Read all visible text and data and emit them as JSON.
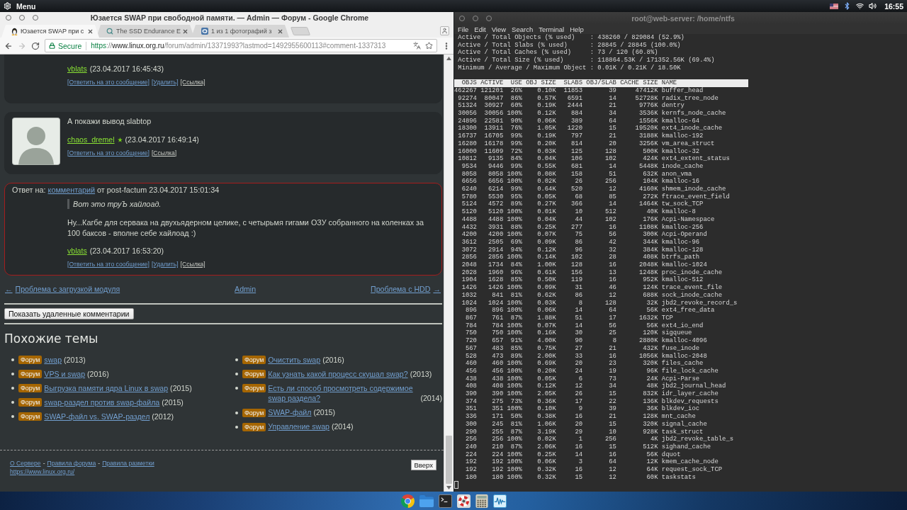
{
  "top_panel": {
    "menu_label": "Menu",
    "clock": "16:55"
  },
  "browser": {
    "title": "Юзается SWAP при свободной памяти. — Admin — Форум - Google Chrome",
    "tabs": [
      {
        "title": "Юзается SWAP при с",
        "kind": "penguin",
        "selected": true
      },
      {
        "title": "The SSD Endurance E",
        "kind": "magnifier",
        "selected": false
      },
      {
        "title": "1 из 1 фотографий з",
        "kind": "tile",
        "selected": false
      }
    ],
    "address": {
      "security": "Secure",
      "scheme": "https",
      "separator": "://",
      "host": "www.linux.org.ru",
      "path": "/forum/admin/13371993?lastmod=1492955600113#comment-1337313"
    }
  },
  "page": {
    "comments": [
      {
        "highlighted": false,
        "avatar": false,
        "author": "vblats",
        "starred": false,
        "time": "(23.04.2017 16:45:43)",
        "actions": [
          {
            "label": "[Ответить на это сообщение]",
            "kind": "action"
          },
          {
            "label": "[Удалить]",
            "kind": "action"
          },
          {
            "label": "[Ссылка]",
            "kind": "permalink"
          }
        ]
      },
      {
        "highlighted": false,
        "avatar": true,
        "text": "А покажи вывод slabtop",
        "author": "chaos_dremel",
        "starred": true,
        "time": "(23.04.2017 16:49:14)",
        "actions": [
          {
            "label": "[Ответить на это сообщение]",
            "kind": "action"
          },
          {
            "label": "[Ссылка]",
            "kind": "permalink"
          }
        ]
      },
      {
        "highlighted": true,
        "avatar": false,
        "reply_to": {
          "prefix": "Ответ на:",
          "link": "комментарий",
          "rest": "от post-factum 23.04.2017 15:01:34"
        },
        "quote": "Вот это труЪ хайлоад.",
        "text": "Ну...Кагбе для сервака на двухьядерном целике, с четырьмя гигами ОЗУ собранного на коленках за 100 баксов - вполне себе хайлоад :)",
        "author": "vblats",
        "starred": false,
        "time": "(23.04.2017 16:53:20)",
        "actions": [
          {
            "label": "[Ответить на это сообщение]",
            "kind": "action"
          },
          {
            "label": "[Удалить]",
            "kind": "action"
          },
          {
            "label": "[Ссылка]",
            "kind": "permalink"
          }
        ]
      }
    ],
    "nav": {
      "prev_arrow": "←",
      "prev": "Проблема с загрузкой модуля",
      "center": "Admin",
      "next": "Проблема с HDD",
      "next_arrow": "→"
    },
    "show_deleted_button": "Показать удаленные комментарии",
    "related": {
      "title": "Похожие темы",
      "columns": [
        [
          {
            "tag": "Форум",
            "title": "swap",
            "year": "(2013)"
          },
          {
            "tag": "Форум",
            "title": "VPS и swap",
            "year": "(2016)"
          },
          {
            "tag": "Форум",
            "title": "Выгрузка памяти ядра Linux в swap",
            "year": "(2015)"
          },
          {
            "tag": "Форум",
            "title": "swap-раздел против swap-файла",
            "year": "(2015)"
          },
          {
            "tag": "Форум",
            "title": "SWAP-файл vs. SWAP-раздел",
            "year": "(2012)"
          }
        ],
        [
          {
            "tag": "Форум",
            "title": "Очистить swap",
            "year": "(2016)"
          },
          {
            "tag": "Форум",
            "title": "Как узнать какой процесс скушал swap?",
            "year": "(2013)"
          },
          {
            "tag": "Форум",
            "title": "Есть ли способ просмотреть содержимое swap раздела?",
            "year": "(2014)"
          },
          {
            "tag": "Форум",
            "title": "SWAP-файл",
            "year": "(2015)"
          },
          {
            "tag": "Форум",
            "title": "Управление swap",
            "year": "(2014)"
          }
        ]
      ]
    },
    "footer": {
      "links": [
        {
          "kind": "link",
          "text": "О Сервере"
        },
        {
          "kind": "separator",
          "text": "-"
        },
        {
          "kind": "link",
          "text": "Правила форума"
        },
        {
          "kind": "separator",
          "text": "-"
        },
        {
          "kind": "link",
          "text": "Правила разметки"
        }
      ],
      "site_url": "https://www.linux.org.ru/",
      "top_button": "Вверх"
    }
  },
  "terminal": {
    "title": "root@web-server: /home/ntfs",
    "menu": [
      "File",
      "Edit",
      "View",
      "Search",
      "Terminal",
      "Help"
    ],
    "summary": [
      "Active / Total Objects (% used)    : 438260 / 829084 (52.9%)",
      "Active / Total Slabs (% used)      : 28845 / 28845 (100.0%)",
      "Active / Total Caches (% used)     : 73 / 120 (60.8%)",
      "Active / Total Size (% used)       : 118864.53K / 171352.56K (69.4%)",
      "Minimum / Average / Maximum Object : 0.01K / 0.21K / 18.50K"
    ],
    "table": {
      "columns": [
        "OBJS",
        "ACTIVE",
        "USE",
        "OBJ SIZE",
        "SLABS",
        "OBJ/SLAB",
        "CACHE SIZE",
        "NAME"
      ],
      "rows": [
        [
          "462267",
          "121201",
          "26%",
          "0.10K",
          "11853",
          "39",
          "47412K",
          "buffer_head"
        ],
        [
          "92274",
          "80047",
          "86%",
          "0.57K",
          "6591",
          "14",
          "52728K",
          "radix_tree_node"
        ],
        [
          "51324",
          "30927",
          "60%",
          "0.19K",
          "2444",
          "21",
          "9776K",
          "dentry"
        ],
        [
          "30056",
          "30056",
          "100%",
          "0.12K",
          "884",
          "34",
          "3536K",
          "kernfs_node_cache"
        ],
        [
          "24896",
          "22581",
          "90%",
          "0.06K",
          "389",
          "64",
          "1556K",
          "kmalloc-64"
        ],
        [
          "18300",
          "13911",
          "76%",
          "1.05K",
          "1220",
          "15",
          "19520K",
          "ext4_inode_cache"
        ],
        [
          "16737",
          "16705",
          "99%",
          "0.19K",
          "797",
          "21",
          "3188K",
          "kmalloc-192"
        ],
        [
          "16280",
          "16178",
          "99%",
          "0.20K",
          "814",
          "20",
          "3256K",
          "vm_area_struct"
        ],
        [
          "16000",
          "11609",
          "72%",
          "0.03K",
          "125",
          "128",
          "500K",
          "kmalloc-32"
        ],
        [
          "10812",
          "9135",
          "84%",
          "0.04K",
          "106",
          "102",
          "424K",
          "ext4_extent_status"
        ],
        [
          "9534",
          "9446",
          "99%",
          "0.55K",
          "681",
          "14",
          "5448K",
          "inode_cache"
        ],
        [
          "8058",
          "8058",
          "100%",
          "0.08K",
          "158",
          "51",
          "632K",
          "anon_vma"
        ],
        [
          "6656",
          "6656",
          "100%",
          "0.02K",
          "26",
          "256",
          "104K",
          "kmalloc-16"
        ],
        [
          "6240",
          "6214",
          "99%",
          "0.64K",
          "520",
          "12",
          "4160K",
          "shmem_inode_cache"
        ],
        [
          "5780",
          "5530",
          "95%",
          "0.05K",
          "68",
          "85",
          "272K",
          "ftrace_event_field"
        ],
        [
          "5124",
          "4572",
          "89%",
          "0.27K",
          "366",
          "14",
          "1464K",
          "tw_sock_TCP"
        ],
        [
          "5120",
          "5120",
          "100%",
          "0.01K",
          "10",
          "512",
          "40K",
          "kmalloc-8"
        ],
        [
          "4488",
          "4488",
          "100%",
          "0.04K",
          "44",
          "102",
          "176K",
          "Acpi-Namespace"
        ],
        [
          "4432",
          "3931",
          "88%",
          "0.25K",
          "277",
          "16",
          "1108K",
          "kmalloc-256"
        ],
        [
          "4200",
          "4200",
          "100%",
          "0.07K",
          "75",
          "56",
          "300K",
          "Acpi-Operand"
        ],
        [
          "3612",
          "2505",
          "69%",
          "0.09K",
          "86",
          "42",
          "344K",
          "kmalloc-96"
        ],
        [
          "3072",
          "2914",
          "94%",
          "0.12K",
          "96",
          "32",
          "384K",
          "kmalloc-128"
        ],
        [
          "2856",
          "2856",
          "100%",
          "0.14K",
          "102",
          "28",
          "408K",
          "btrfs_path"
        ],
        [
          "2048",
          "1734",
          "84%",
          "1.00K",
          "128",
          "16",
          "2048K",
          "kmalloc-1024"
        ],
        [
          "2028",
          "1960",
          "96%",
          "0.61K",
          "156",
          "13",
          "1248K",
          "proc_inode_cache"
        ],
        [
          "1904",
          "1628",
          "85%",
          "0.50K",
          "119",
          "16",
          "952K",
          "kmalloc-512"
        ],
        [
          "1426",
          "1426",
          "100%",
          "0.09K",
          "31",
          "46",
          "124K",
          "trace_event_file"
        ],
        [
          "1032",
          "841",
          "81%",
          "0.62K",
          "86",
          "12",
          "688K",
          "sock_inode_cache"
        ],
        [
          "1024",
          "1024",
          "100%",
          "0.03K",
          "8",
          "128",
          "32K",
          "jbd2_revoke_record_s"
        ],
        [
          "896",
          "896",
          "100%",
          "0.06K",
          "14",
          "64",
          "56K",
          "ext4_free_data"
        ],
        [
          "867",
          "761",
          "87%",
          "1.88K",
          "51",
          "17",
          "1632K",
          "TCP"
        ],
        [
          "784",
          "784",
          "100%",
          "0.07K",
          "14",
          "56",
          "56K",
          "ext4_io_end"
        ],
        [
          "750",
          "750",
          "100%",
          "0.16K",
          "30",
          "25",
          "120K",
          "sigqueue"
        ],
        [
          "720",
          "657",
          "91%",
          "4.00K",
          "90",
          "8",
          "2880K",
          "kmalloc-4096"
        ],
        [
          "567",
          "483",
          "85%",
          "0.75K",
          "27",
          "21",
          "432K",
          "fuse_inode"
        ],
        [
          "528",
          "473",
          "89%",
          "2.00K",
          "33",
          "16",
          "1056K",
          "kmalloc-2048"
        ],
        [
          "460",
          "460",
          "100%",
          "0.69K",
          "20",
          "23",
          "320K",
          "files_cache"
        ],
        [
          "456",
          "456",
          "100%",
          "0.20K",
          "24",
          "19",
          "96K",
          "file_lock_cache"
        ],
        [
          "438",
          "438",
          "100%",
          "0.05K",
          "6",
          "73",
          "24K",
          "Acpi-Parse"
        ],
        [
          "408",
          "408",
          "100%",
          "0.12K",
          "12",
          "34",
          "48K",
          "jbd2_journal_head"
        ],
        [
          "390",
          "390",
          "100%",
          "2.05K",
          "26",
          "15",
          "832K",
          "idr_layer_cache"
        ],
        [
          "374",
          "275",
          "73%",
          "0.36K",
          "17",
          "22",
          "136K",
          "blkdev_requests"
        ],
        [
          "351",
          "351",
          "100%",
          "0.10K",
          "9",
          "39",
          "36K",
          "blkdev_ioc"
        ],
        [
          "336",
          "171",
          "50%",
          "0.38K",
          "16",
          "21",
          "128K",
          "mnt_cache"
        ],
        [
          "300",
          "245",
          "81%",
          "1.06K",
          "20",
          "15",
          "320K",
          "signal_cache"
        ],
        [
          "290",
          "255",
          "87%",
          "3.19K",
          "29",
          "10",
          "928K",
          "task_struct"
        ],
        [
          "256",
          "256",
          "100%",
          "0.02K",
          "1",
          "256",
          "4K",
          "jbd2_revoke_table_s"
        ],
        [
          "240",
          "210",
          "87%",
          "2.06K",
          "16",
          "15",
          "512K",
          "sighand_cache"
        ],
        [
          "224",
          "224",
          "100%",
          "0.25K",
          "14",
          "16",
          "56K",
          "dquot"
        ],
        [
          "192",
          "192",
          "100%",
          "0.06K",
          "3",
          "64",
          "12K",
          "kmem_cache_node"
        ],
        [
          "192",
          "192",
          "100%",
          "0.32K",
          "16",
          "12",
          "64K",
          "request_sock_TCP"
        ],
        [
          "180",
          "180",
          "100%",
          "0.32K",
          "15",
          "12",
          "60K",
          "taskstats"
        ]
      ]
    }
  }
}
